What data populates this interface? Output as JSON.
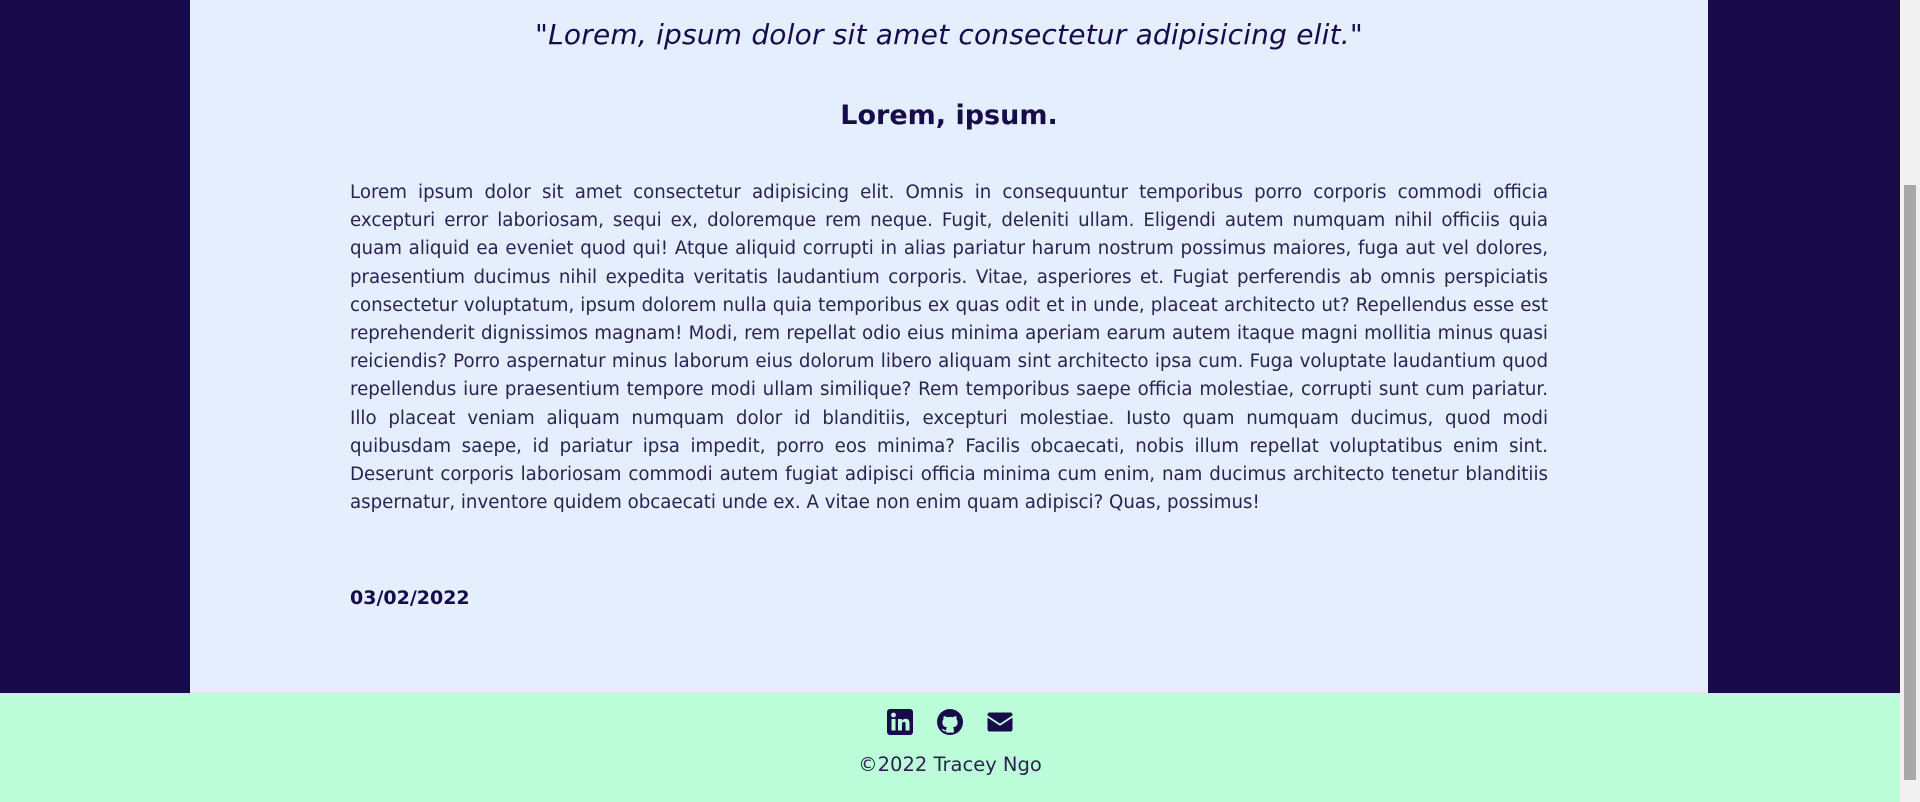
{
  "post": {
    "quote": "\"Lorem, ipsum dolor sit amet consectetur adipisicing elit.\"",
    "title": "Lorem, ipsum.",
    "body": "Lorem ipsum dolor sit amet consectetur adipisicing elit. Omnis in consequuntur temporibus porro corporis commodi officia excepturi error laboriosam, sequi ex, doloremque rem neque. Fugit, deleniti ullam. Eligendi autem numquam nihil officiis quia quam aliquid ea eveniet quod qui! Atque aliquid corrupti in alias pariatur harum nostrum possimus maiores, fuga aut vel dolores, praesentium ducimus nihil expedita veritatis laudantium corporis. Vitae, asperiores et. Fugiat perferendis ab omnis perspiciatis consectetur voluptatum, ipsum dolorem nulla quia temporibus ex quas odit et in unde, placeat architecto ut? Repellendus esse est reprehenderit dignissimos magnam! Modi, rem repellat odio eius minima aperiam earum autem itaque magni mollitia minus quasi reiciendis? Porro aspernatur minus laborum eius dolorum libero aliquam sint architecto ipsa cum. Fuga voluptate laudantium quod repellendus iure praesentium tempore modi ullam similique? Rem temporibus saepe officia molestiae, corrupti sunt cum pariatur. Illo placeat veniam aliquam numquam dolor id blanditiis, excepturi molestiae. Iusto quam numquam ducimus, quod modi quibusdam saepe, id pariatur ipsa impedit, porro eos minima? Facilis obcaecati, nobis illum repellat voluptatibus enim sint. Deserunt corporis laboriosam commodi autem fugiat adipisci officia minima cum enim, nam ducimus architecto tenetur blanditiis aspernatur, inventore quidem obcaecati unde ex. A vitae non enim quam adipisci? Quas, possimus!",
    "date": "03/02/2022"
  },
  "footer": {
    "icons": [
      "linkedin-icon",
      "github-icon",
      "email-icon"
    ],
    "copyright": "©2022 Tracey Ngo"
  },
  "colors": {
    "page_background": "#170b4a",
    "content_background": "#e4eefc",
    "footer_background": "#bbfed9",
    "text_primary": "#170b4a"
  }
}
